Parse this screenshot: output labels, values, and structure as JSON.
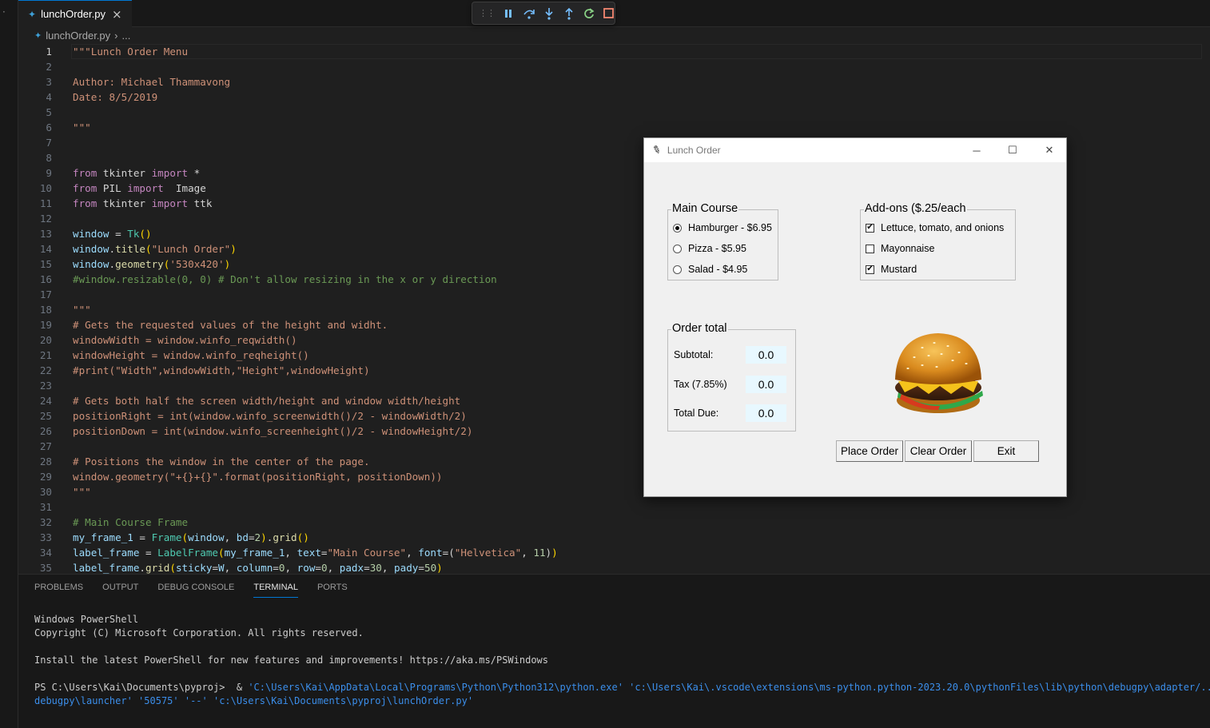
{
  "tab": {
    "label": "lunchOrder.py",
    "close": "×"
  },
  "breadcrumb": {
    "file": "lunchOrder.py",
    "sep": "›",
    "more": "..."
  },
  "debug_toolbar": {
    "icons": [
      "pause-icon",
      "step-over-icon",
      "step-into-icon",
      "step-out-icon",
      "restart-icon",
      "stop-icon"
    ]
  },
  "editor": {
    "current_line": 1,
    "lines": [
      [
        [
          "s",
          "\"\"\"Lunch Order Menu"
        ]
      ],
      [],
      [
        [
          "s",
          "Author: Michael Thammavong"
        ]
      ],
      [
        [
          "s",
          "Date: 8/5/2019"
        ]
      ],
      [],
      [
        [
          "s",
          "\"\"\""
        ]
      ],
      [],
      [],
      [
        [
          "k",
          "from"
        ],
        [
          "p",
          " tkinter "
        ],
        [
          "k",
          "import"
        ],
        [
          "p",
          " *"
        ]
      ],
      [
        [
          "k",
          "from"
        ],
        [
          "p",
          " PIL "
        ],
        [
          "k",
          "import"
        ],
        [
          "p",
          "  Image"
        ]
      ],
      [
        [
          "k",
          "from"
        ],
        [
          "p",
          " tkinter "
        ],
        [
          "k",
          "import"
        ],
        [
          "p",
          " ttk"
        ]
      ],
      [],
      [
        [
          "v",
          "window"
        ],
        [
          "p",
          " = "
        ],
        [
          "c",
          "Tk"
        ],
        [
          "b",
          "()"
        ]
      ],
      [
        [
          "v",
          "window"
        ],
        [
          "p",
          "."
        ],
        [
          "f",
          "title"
        ],
        [
          "b",
          "("
        ],
        [
          "s",
          "\"Lunch Order\""
        ],
        [
          "b",
          ")"
        ]
      ],
      [
        [
          "v",
          "window"
        ],
        [
          "p",
          "."
        ],
        [
          "f",
          "geometry"
        ],
        [
          "b",
          "("
        ],
        [
          "s",
          "'530x420'"
        ],
        [
          "b",
          ")"
        ]
      ],
      [
        [
          "m",
          "#window.resizable(0, 0) # Don't allow resizing in the x or y direction"
        ]
      ],
      [],
      [
        [
          "s",
          "\"\"\""
        ]
      ],
      [
        [
          "s",
          "# Gets the requested values of the height and widht."
        ]
      ],
      [
        [
          "s",
          "windowWidth = window.winfo_reqwidth()"
        ]
      ],
      [
        [
          "s",
          "windowHeight = window.winfo_reqheight()"
        ]
      ],
      [
        [
          "s",
          "#print(\"Width\",windowWidth,\"Height\",windowHeight)"
        ]
      ],
      [],
      [
        [
          "s",
          "# Gets both half the screen width/height and window width/height"
        ]
      ],
      [
        [
          "s",
          "positionRight = int(window.winfo_screenwidth()/2 - windowWidth/2)"
        ]
      ],
      [
        [
          "s",
          "positionDown = int(window.winfo_screenheight()/2 - windowHeight/2)"
        ]
      ],
      [],
      [
        [
          "s",
          "# Positions the window in the center of the page."
        ]
      ],
      [
        [
          "s",
          "window.geometry(\"+{}+{}\".format(positionRight, positionDown))"
        ]
      ],
      [
        [
          "s",
          "\"\"\""
        ]
      ],
      [],
      [
        [
          "m",
          "# Main Course Frame"
        ]
      ],
      [
        [
          "v",
          "my_frame_1"
        ],
        [
          "p",
          " = "
        ],
        [
          "c",
          "Frame"
        ],
        [
          "b",
          "("
        ],
        [
          "v",
          "window"
        ],
        [
          "p",
          ", "
        ],
        [
          "v",
          "bd"
        ],
        [
          "p",
          "="
        ],
        [
          "n",
          "2"
        ],
        [
          "b",
          ")"
        ],
        [
          "p",
          "."
        ],
        [
          "f",
          "grid"
        ],
        [
          "b",
          "()"
        ]
      ],
      [
        [
          "v",
          "label_frame"
        ],
        [
          "p",
          " = "
        ],
        [
          "c",
          "LabelFrame"
        ],
        [
          "b",
          "("
        ],
        [
          "v",
          "my_frame_1"
        ],
        [
          "p",
          ", "
        ],
        [
          "v",
          "text"
        ],
        [
          "p",
          "="
        ],
        [
          "s",
          "\"Main Course\""
        ],
        [
          "p",
          ", "
        ],
        [
          "v",
          "font"
        ],
        [
          "p",
          "=("
        ],
        [
          "s",
          "\"Helvetica\""
        ],
        [
          "p",
          ", "
        ],
        [
          "n",
          "11"
        ],
        [
          "p",
          ")"
        ],
        [
          "b",
          ")"
        ]
      ],
      [
        [
          "v",
          "label_frame"
        ],
        [
          "p",
          "."
        ],
        [
          "f",
          "grid"
        ],
        [
          "b",
          "("
        ],
        [
          "v",
          "sticky"
        ],
        [
          "p",
          "="
        ],
        [
          "v",
          "W"
        ],
        [
          "p",
          ", "
        ],
        [
          "v",
          "column"
        ],
        [
          "p",
          "="
        ],
        [
          "n",
          "0"
        ],
        [
          "p",
          ", "
        ],
        [
          "v",
          "row"
        ],
        [
          "p",
          "="
        ],
        [
          "n",
          "0"
        ],
        [
          "p",
          ", "
        ],
        [
          "v",
          "padx"
        ],
        [
          "p",
          "="
        ],
        [
          "n",
          "30"
        ],
        [
          "p",
          ", "
        ],
        [
          "v",
          "pady"
        ],
        [
          "p",
          "="
        ],
        [
          "n",
          "50"
        ],
        [
          "b",
          ")"
        ]
      ]
    ]
  },
  "panel": {
    "tabs": [
      "PROBLEMS",
      "OUTPUT",
      "DEBUG CONSOLE",
      "TERMINAL",
      "PORTS"
    ],
    "active_tab": "TERMINAL",
    "terminal": {
      "line1": "Windows PowerShell",
      "line2": "Copyright (C) Microsoft Corporation. All rights reserved.",
      "line3": "Install the latest PowerShell for new features and improvements! https://aka.ms/PSWindows",
      "prompt": "PS C:\\Users\\Kai\\Documents\\pyproj>  & ",
      "cmd1": "'C:\\Users\\Kai\\AppData\\Local\\Programs\\Python\\Python312\\python.exe' 'c:\\Users\\Kai\\.vscode\\extensions\\ms-python.python-2023.20.0\\pythonFiles\\lib\\python\\debugpy\\adapter/../..\\",
      "cmd2": "debugpy\\launcher' '50575' '--' 'c:\\Users\\Kai\\Documents\\pyproj\\lunchOrder.py'"
    }
  },
  "tk_window": {
    "title": "Lunch Order",
    "minimize": "─",
    "maximize": "☐",
    "close": "✕",
    "main_course": {
      "label": "Main Course",
      "options": [
        "Hamburger - $6.95",
        "Pizza - $5.95",
        "Salad - $4.95"
      ],
      "selected": 0
    },
    "addons": {
      "label": "Add-ons ($.25/each",
      "options": [
        "Lettuce, tomato, and onions",
        "Mayonnaise",
        "Mustard"
      ],
      "checked": [
        true,
        false,
        true
      ]
    },
    "order_total": {
      "label": "Order total",
      "subtotal_label": "Subtotal:",
      "subtotal": "0.0",
      "tax_label": "Tax (7.85%)",
      "tax": "0.0",
      "total_label": "Total Due:",
      "total": "0.0"
    },
    "buttons": {
      "place": "Place Order",
      "clear": "Clear Order",
      "exit": "Exit"
    }
  }
}
